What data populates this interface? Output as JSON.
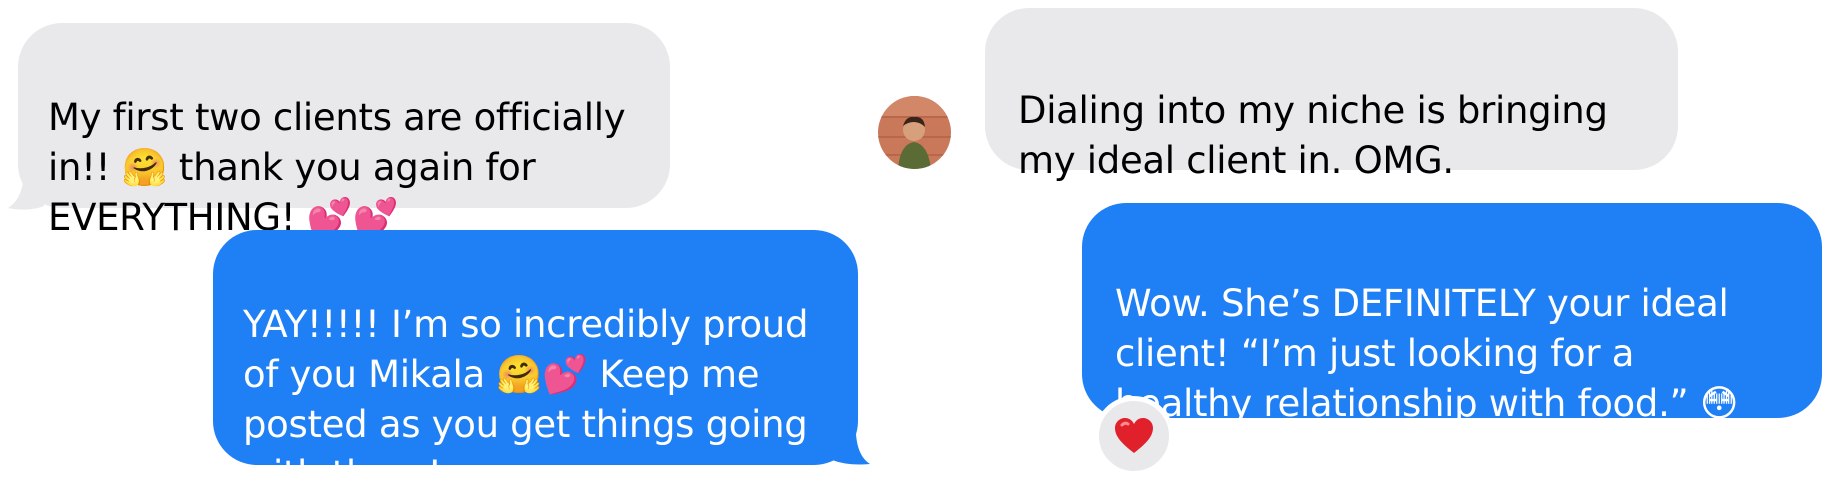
{
  "messages": [
    {
      "id": "received-1",
      "side": "received",
      "text": "My first two clients are officially\nin!! 🤗 thank you again for\nEVERYTHING! 💕💕"
    },
    {
      "id": "sent-1",
      "side": "sent",
      "text": "YAY!!!!! I’m so incredibly proud\nof you Mikala 🤗💕 Keep me\nposted as you get things going\nwith them!"
    },
    {
      "id": "received-2",
      "side": "received",
      "text": "Dialing into my niche is bringing\nmy ideal client in. OMG."
    },
    {
      "id": "sent-2",
      "side": "sent",
      "text": "Wow. She’s DEFINITELY your ideal\nclient! “I’m just looking for a\nhealthy relationship with food.” 😳",
      "reaction": "❤️"
    }
  ],
  "colors": {
    "received_bubble": "#e9e9eb",
    "sent_bubble": "#1f7ff5",
    "reaction": "#e0212b"
  },
  "avatar": {
    "icon": "person-avatar-icon"
  }
}
